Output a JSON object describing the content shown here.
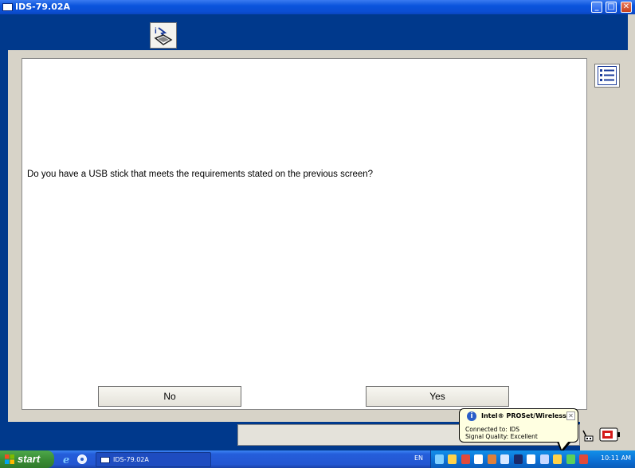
{
  "window": {
    "title": "IDS-79.02A",
    "min_label": "_",
    "max_label": "□",
    "close_label": "✕"
  },
  "toolbar": {
    "tool_icon": "ids-help-icon"
  },
  "main": {
    "question": "Do you have a USB stick that meets the requirements stated on the previous screen?",
    "no_label": "No",
    "yes_label": "Yes"
  },
  "balloon": {
    "title": "Intel® PROSet/Wireless",
    "line1": "Connected to: IDS",
    "line2": "Signal Quality: Excellent"
  },
  "taskbar": {
    "start_label": "start",
    "task_label": "IDS-79.02A",
    "language": "EN",
    "clock": "10:11 AM"
  },
  "colors": {
    "app_blue": "#00398c",
    "panel_grey": "#d7d3c8",
    "balloon_bg": "#ffffe1",
    "start_green": "#3b8e36"
  }
}
